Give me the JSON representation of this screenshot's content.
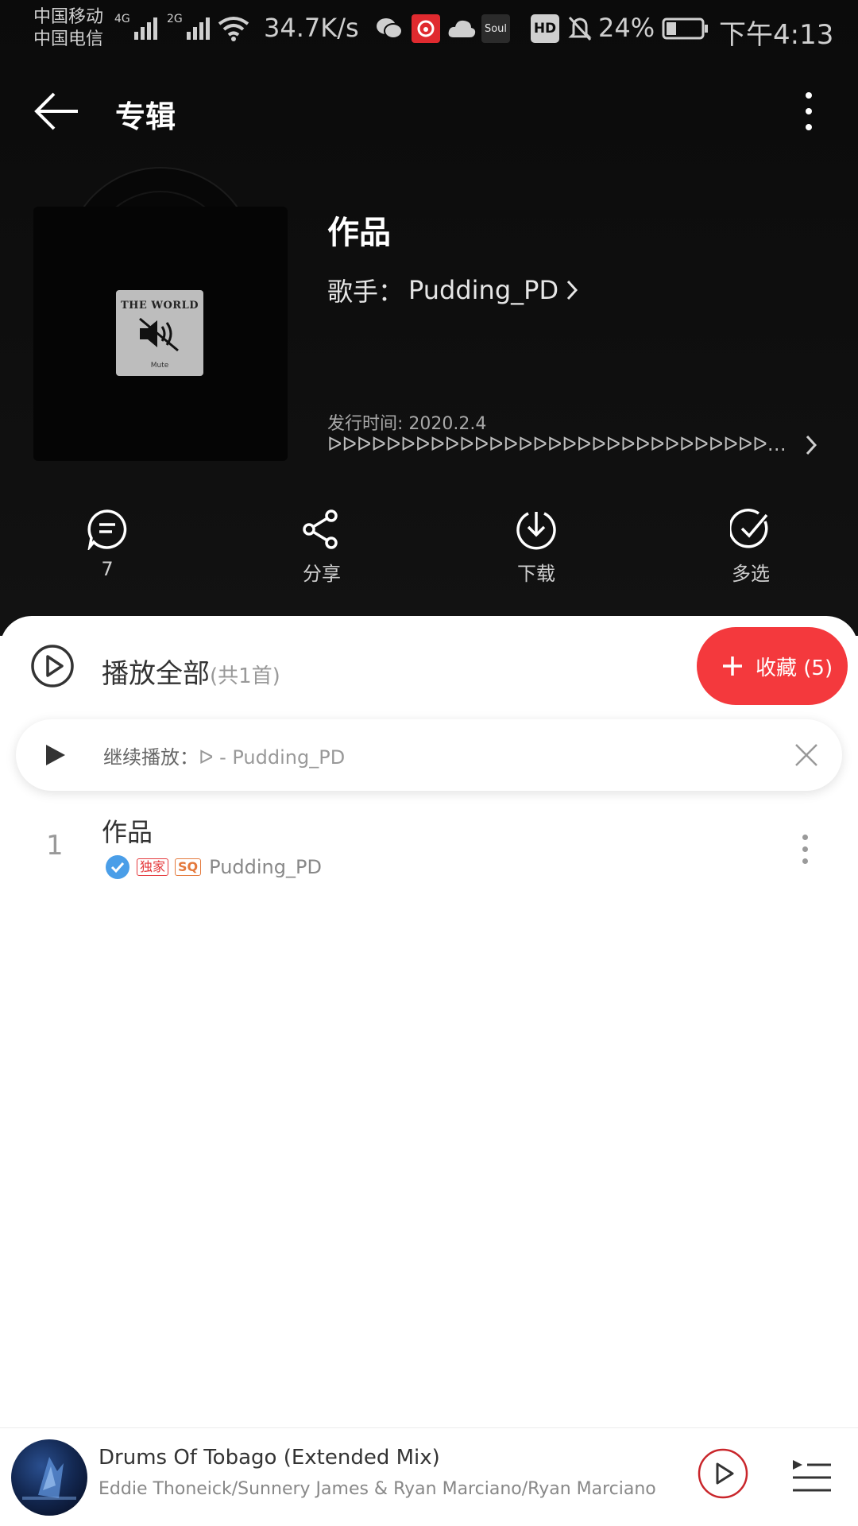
{
  "status_bar": {
    "carrier_1": "中国移动",
    "carrier_2": "中国电信",
    "net_1": "4G",
    "net_2": "2G",
    "net_speed": "34.7K/s",
    "battery": "24%",
    "time": "下午4:13",
    "hd": "HD",
    "soul": "Soul"
  },
  "header": {
    "title": "专辑"
  },
  "album": {
    "cover_text": "THE WORLD",
    "cover_caption": "Mute",
    "name": "作品",
    "artist_label": "歌手：",
    "artist": "Pudding_PD",
    "release_label": "发行时间:",
    "release_date": "2020.2.4",
    "description": "ᐅᐅᐅᐅᐅᐅᐅᐅᐅᐅᐅᐅᐅᐅᐅᐅᐅᐅᐅᐅᐅᐅᐅᐅᐅᐅᐅᐅᐅᐅᐅᐅᐅᐅᐅᐅᐅᐅᐅᐅᐅᐅᐅᐅ..."
  },
  "actions": [
    {
      "id": "comment",
      "label": "7"
    },
    {
      "id": "share",
      "label": "分享"
    },
    {
      "id": "download",
      "label": "下载"
    },
    {
      "id": "multi",
      "label": "多选"
    }
  ],
  "list": {
    "play_all": "播放全部",
    "count": "(共1首)",
    "collect": "收藏 (5)",
    "resume_label": "继续播放：",
    "resume_song": "ᐅ - Pudding_PD"
  },
  "tracks": [
    {
      "num": "1",
      "title": "作品",
      "badge_exclusive": "独家",
      "badge_sq": "SQ",
      "artist": "Pudding_PD"
    }
  ],
  "player": {
    "title": "Drums Of Tobago (Extended Mix)",
    "artist": "Eddie Thoneick/Sunnery James & Ryan Marciano/Ryan Marciano"
  },
  "colors": {
    "accent": "#f4393d",
    "hero_bg": "#0f0f0f",
    "verified": "#4a9ee8"
  }
}
